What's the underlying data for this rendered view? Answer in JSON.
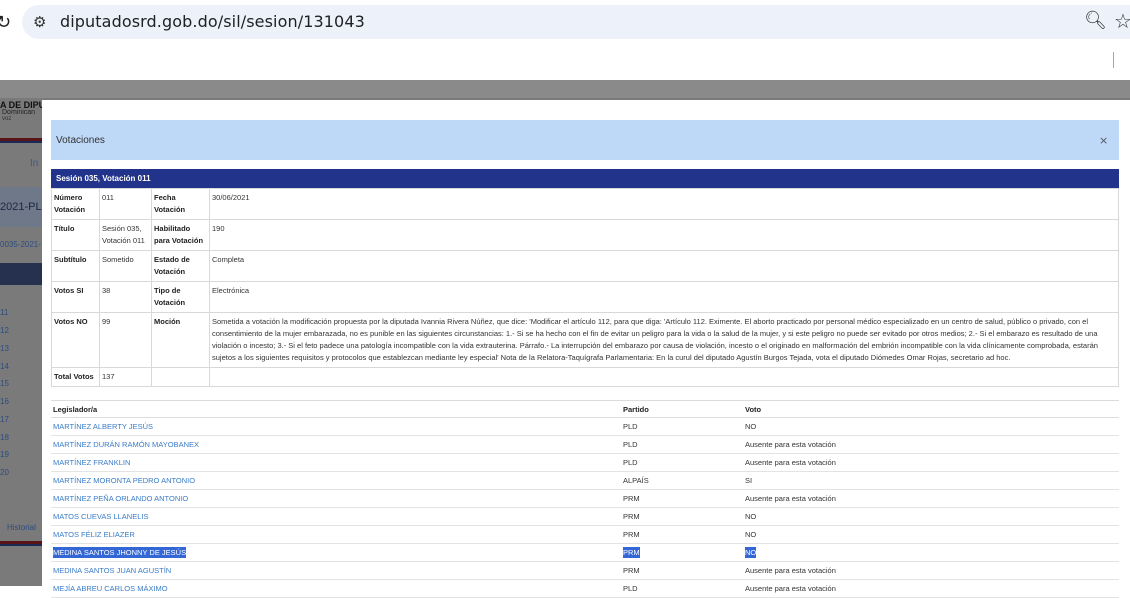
{
  "browser": {
    "url": "diputadosrd.gob.do/sil/sesion/131043"
  },
  "background": {
    "logo_line1": "A DE DIPU",
    "logo_line2": "Dominican",
    "logo_line3": "voz",
    "nav": "In",
    "code": "2021-PLO",
    "link": "0035-2021-",
    "numbers": [
      "11",
      "12",
      "13",
      "14",
      "15",
      "16",
      "17",
      "18",
      "19",
      "20"
    ],
    "historial": "Historial"
  },
  "modal": {
    "title": "Votaciones",
    "close": "×",
    "panel_title": "Sesión 035, Votación 011",
    "details": {
      "numero_label": "Número Votación",
      "numero_value": "011",
      "fecha_label": "Fecha Votación",
      "fecha_value": "30/06/2021",
      "titulo_label": "Título",
      "titulo_value": "Sesión 035, Votación 011",
      "habilitado_label": "Habilitado para Votación",
      "habilitado_value": "190",
      "subtitulo_label": "Subtítulo",
      "subtitulo_value": "Sometido",
      "estado_label": "Estado de Votación",
      "estado_value": "Completa",
      "votos_si_label": "Votos SI",
      "votos_si_value": "38",
      "tipo_label": "Tipo de Votación",
      "tipo_value": "Electrónica",
      "votos_no_label": "Votos NO",
      "votos_no_value": "99",
      "mocion_label": "Moción",
      "mocion_value": "Sometida a votación la modificación propuesta por la diputada Ivannia Rivera Núñez, que dice: 'Modificar el artículo 112, para que diga: 'Artículo 112. Eximente. El aborto practicado por personal médico especializado en un centro de salud, público o privado, con el consentimiento de la mujer embarazada, no es punible en las siguientes circunstancias: 1.- Si se ha hecho con el fin de evitar un peligro para la vida o la salud de la mujer, y si este peligro no puede ser evitado por otros medios; 2.- Si el embarazo es resultado de una violación o incesto; 3.- Si el feto padece una patología incompatible con la vida extrauterina. Párrafo.- La interrupción del embarazo por causa de violación, incesto o el originado en malformación del embrión incompatible con la vida clínicamente comprobada, estarán sujetos a los siguientes requisitos y protocolos que establezcan mediante ley especial' Nota de la Relatora-Taquígrafa Parlamentaria: En la curul del diputado Agustín Burgos Tejada, vota el diputado Diómedes Omar Rojas, secretario ad hoc.",
      "total_label": "Total Votos",
      "total_value": "137"
    },
    "votes": {
      "headers": {
        "legislador": "Legislador/a",
        "partido": "Partido",
        "voto": "Voto"
      },
      "rows": [
        {
          "name": "MARTÍNEZ ALBERTY JESÚS",
          "party": "PLD",
          "vote": "NO"
        },
        {
          "name": "MARTÍNEZ DURÁN RAMÓN MAYOBANEX",
          "party": "PLD",
          "vote": "Ausente para esta votación"
        },
        {
          "name": "MARTÍNEZ FRANKLIN",
          "party": "PLD",
          "vote": "Ausente para esta votación"
        },
        {
          "name": "MARTÍNEZ MORONTA PEDRO ANTONIO",
          "party": "ALPAÍS",
          "vote": "SI"
        },
        {
          "name": "MARTÍNEZ PEÑA ORLANDO ANTONIO",
          "party": "PRM",
          "vote": "Ausente para esta votación"
        },
        {
          "name": "MATOS CUEVAS LLANELIS",
          "party": "PRM",
          "vote": "NO"
        },
        {
          "name": "MATOS FÉLIZ ELIAZER",
          "party": "PRM",
          "vote": "NO"
        },
        {
          "name": "MEDINA SANTOS JHONNY DE JESÚS",
          "party": "PRM",
          "vote": "NO"
        },
        {
          "name": "MEDINA SANTOS JUAN AGUSTÍN",
          "party": "PRM",
          "vote": "Ausente para esta votación"
        },
        {
          "name": "MEJÍA ABREU CARLOS MÁXIMO",
          "party": "PLD",
          "vote": "Ausente para esta votación"
        }
      ],
      "highlight_color": "#3367d6"
    }
  }
}
